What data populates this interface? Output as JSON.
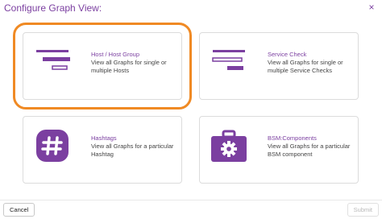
{
  "dialog": {
    "title": "Configure Graph View:",
    "close_glyph": "×"
  },
  "options": [
    {
      "title": "Host / Host Group",
      "desc": "View all Graphs for single or multiple Hosts",
      "icon": "bars-left-icon",
      "selected": true
    },
    {
      "title": "Service Check",
      "desc": "View all Graphs for single or multiple Service Checks",
      "icon": "bars-right-icon",
      "selected": false
    },
    {
      "title": "Hashtags",
      "desc": "View all Graphs for a particular Hashtag",
      "icon": "hashtag-icon",
      "selected": false
    },
    {
      "title": "BSM:Components",
      "desc": "View all Graphs for a particular BSM component",
      "icon": "toolbox-gear-icon",
      "selected": false
    }
  ],
  "footer": {
    "cancel_label": "Cancel",
    "submit_label": "Submit"
  },
  "colors": {
    "accent": "#7b3fa0",
    "selection": "#f08a24"
  }
}
